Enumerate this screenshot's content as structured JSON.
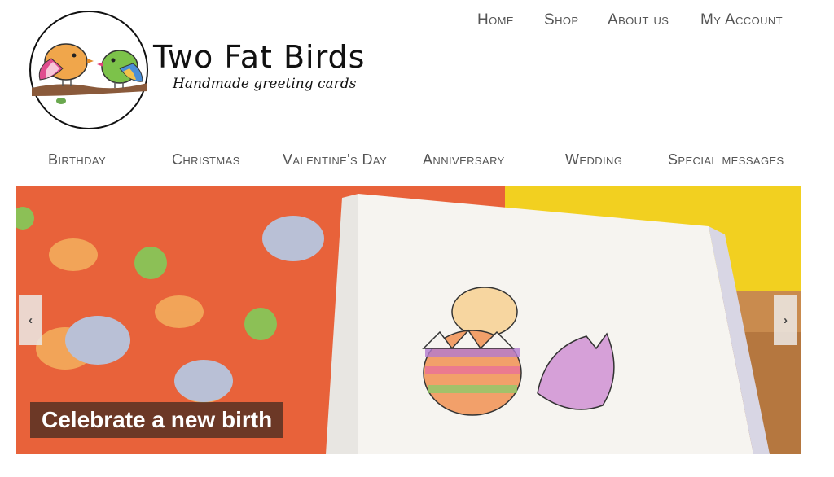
{
  "brand": {
    "name": "Two Fat Birds",
    "tagline": "Handmade greeting cards"
  },
  "topnav": [
    "Home",
    "Shop",
    "About us",
    "My Account"
  ],
  "catnav": [
    "Birthday",
    "Christmas",
    "Valentine's Day",
    "Anniversary",
    "Wedding",
    "Special messages"
  ],
  "slider": {
    "caption": "Celebrate a new birth",
    "prev_icon": "chevron-left-icon",
    "next_icon": "chevron-right-icon",
    "prev_glyph": "‹",
    "next_glyph": "›"
  },
  "colors": {
    "nav_text": "#555555",
    "slide_orange": "#e8623a",
    "slide_yellow": "#f2d020"
  }
}
